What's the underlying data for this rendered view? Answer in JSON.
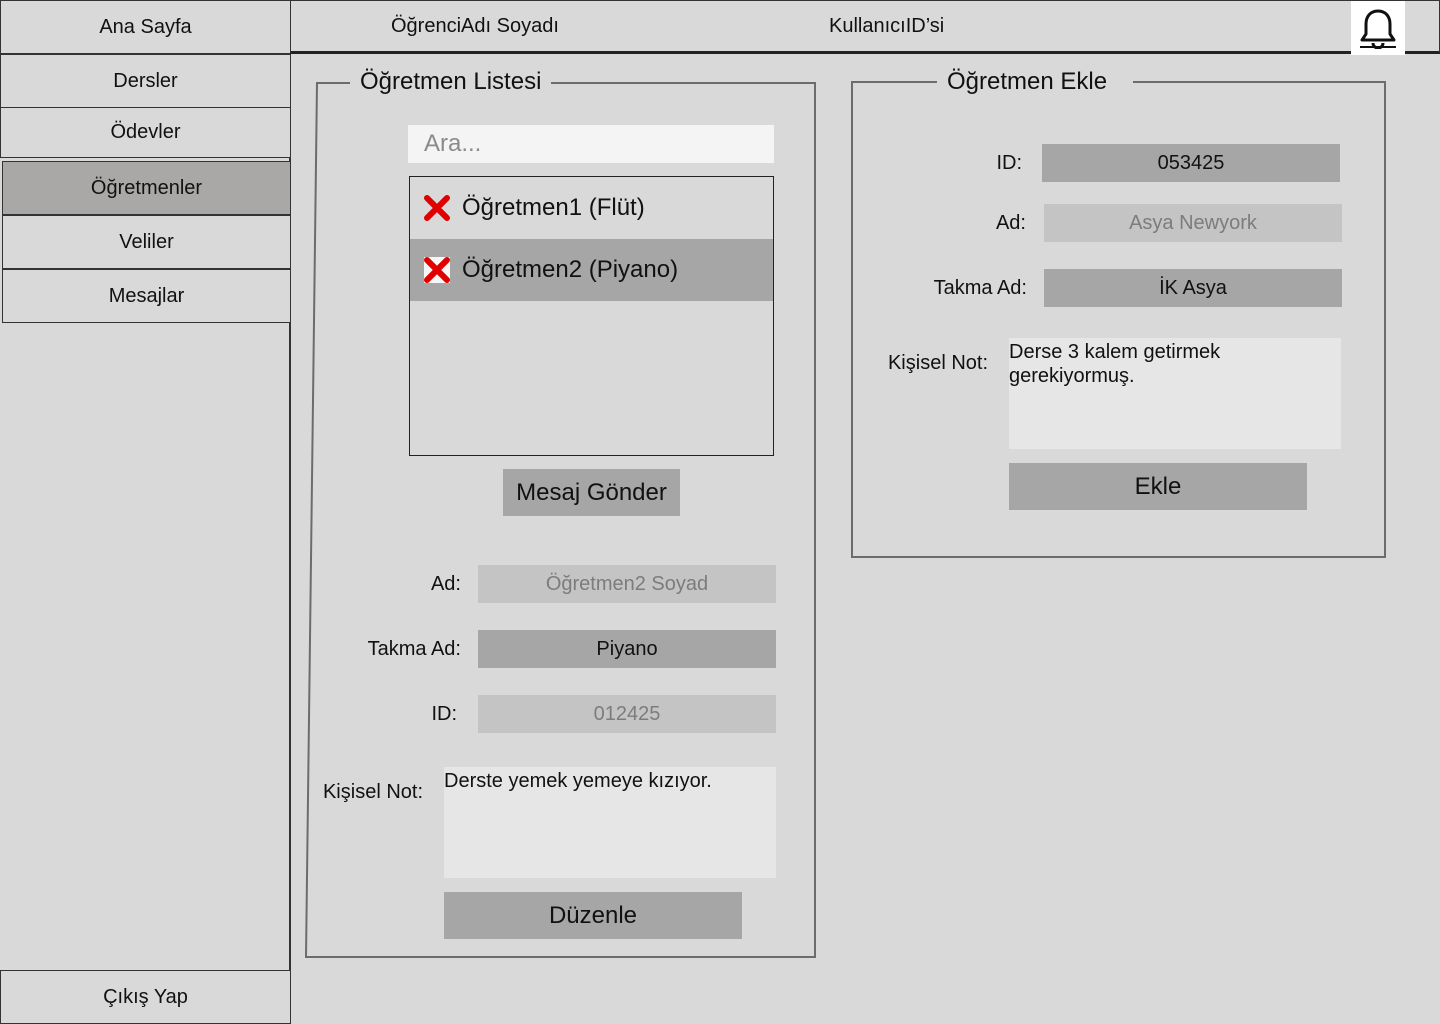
{
  "sidebar": {
    "home": "Ana Sayfa",
    "items": [
      {
        "label": "Dersler"
      },
      {
        "label": "Ödevler"
      },
      {
        "label": "Öğretmenler",
        "active": true
      },
      {
        "label": "Veliler"
      },
      {
        "label": "Mesajlar"
      }
    ],
    "logout": "Çıkış Yap"
  },
  "header": {
    "student_name": "ÖğrenciAdı Soyadı",
    "user_id": "KullanıcıID’si",
    "icon": "bell-icon"
  },
  "teacher_list": {
    "title": "Öğretmen Listesi",
    "search_placeholder": "Ara...",
    "items": [
      {
        "label": "Öğretmen1 (Flüt)",
        "icon": "delete-x-icon"
      },
      {
        "label": "Öğretmen2 (Piyano)",
        "icon": "delete-x-icon",
        "selected": true
      }
    ],
    "send_message_label": "Mesaj Gönder",
    "details": {
      "name_label": "Ad:",
      "name_value": "Öğretmen2 Soyad",
      "nickname_label": "Takma Ad:",
      "nickname_value": "Piyano",
      "id_label": "ID:",
      "id_value": "012425",
      "note_label": "Kişisel Not:",
      "note_value": "Derste yemek yemeye kızıyor."
    },
    "edit_label": "Düzenle"
  },
  "add_teacher": {
    "title": "Öğretmen Ekle",
    "id_label": "ID:",
    "id_value": "053425",
    "name_label": "Ad:",
    "name_placeholder": "Asya Newyork",
    "nickname_label": "Takma Ad:",
    "nickname_value": "İK Asya",
    "note_label": "Kişisel Not:",
    "note_value": "Derse 3 kalem getirmek gerekiyormuş.",
    "add_label": "Ekle"
  },
  "colors": {
    "background": "#d9d9d9",
    "active_nav": "#aaa7a7",
    "button": "#a6a6a6",
    "delete_icon": "#e00000"
  }
}
